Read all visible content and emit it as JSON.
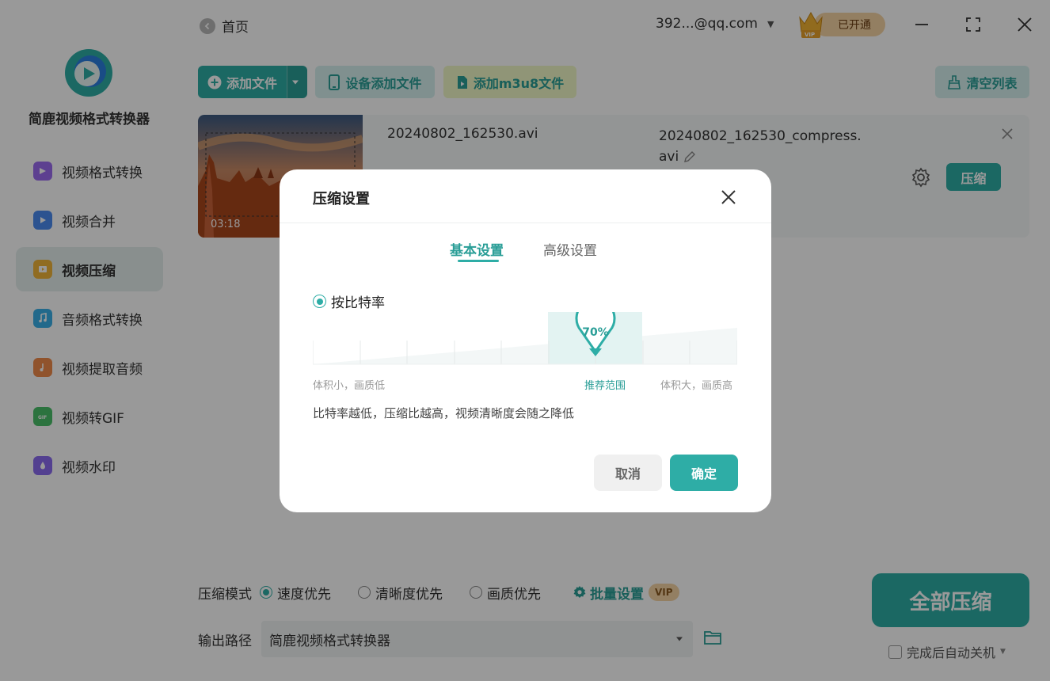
{
  "app": {
    "name": "简鹿视频格式转换器",
    "brand_color": "#2eada6"
  },
  "sidebar": {
    "items": [
      {
        "label": "视频格式转换",
        "icon": "video-convert-icon",
        "color": "#9b6cf0",
        "active": false
      },
      {
        "label": "视频合并",
        "icon": "video-merge-icon",
        "color": "#4a8bf0",
        "active": false
      },
      {
        "label": "视频压缩",
        "icon": "video-compress-icon",
        "color": "#f0b53a",
        "active": true
      },
      {
        "label": "音频格式转换",
        "icon": "audio-convert-icon",
        "color": "#3ab0e8",
        "active": false
      },
      {
        "label": "视频提取音频",
        "icon": "extract-audio-icon",
        "color": "#f08a4a",
        "active": false
      },
      {
        "label": "视频转GIF",
        "icon": "gif-icon",
        "color": "#4ac06a",
        "active": false
      },
      {
        "label": "视频水印",
        "icon": "watermark-icon",
        "color": "#8a6cf0",
        "active": false
      }
    ]
  },
  "header": {
    "home_label": "首页",
    "account": "392...@qq.com",
    "vip_status": "已开通"
  },
  "toolbar": {
    "add_file": "添加文件",
    "device_add": "设备添加文件",
    "add_m3u8": "添加m3u8文件",
    "clear_list": "清空列表"
  },
  "file": {
    "duration": "03:18",
    "name": "20240802_162530.avi",
    "output_name": "20240802_162530_compress.avi",
    "compress_label": "压缩"
  },
  "bottom": {
    "mode_label": "压缩模式",
    "modes": [
      {
        "label": "速度优先",
        "selected": true
      },
      {
        "label": "清晰度优先",
        "selected": false
      },
      {
        "label": "画质优先",
        "selected": false
      }
    ],
    "batch_label": "批量设置",
    "vip_tag": "VIP",
    "output_label": "输出路径",
    "output_path": "简鹿视频格式转换器",
    "compress_all": "全部压缩",
    "auto_shutdown": "完成后自动关机"
  },
  "dialog": {
    "title": "压缩设置",
    "tabs": [
      {
        "label": "基本设置",
        "active": true
      },
      {
        "label": "高级设置",
        "active": false
      }
    ],
    "bitrate_option": "按比特率",
    "bitrate_percent": 70,
    "bitrate_label": "70%",
    "label_low": "体积小，画质低",
    "label_recommended": "推荐范围",
    "label_high": "体积大，画质高",
    "hint": "比特率越低，压缩比越高，视频清晰度会随之降低",
    "cancel": "取消",
    "confirm": "确定"
  }
}
